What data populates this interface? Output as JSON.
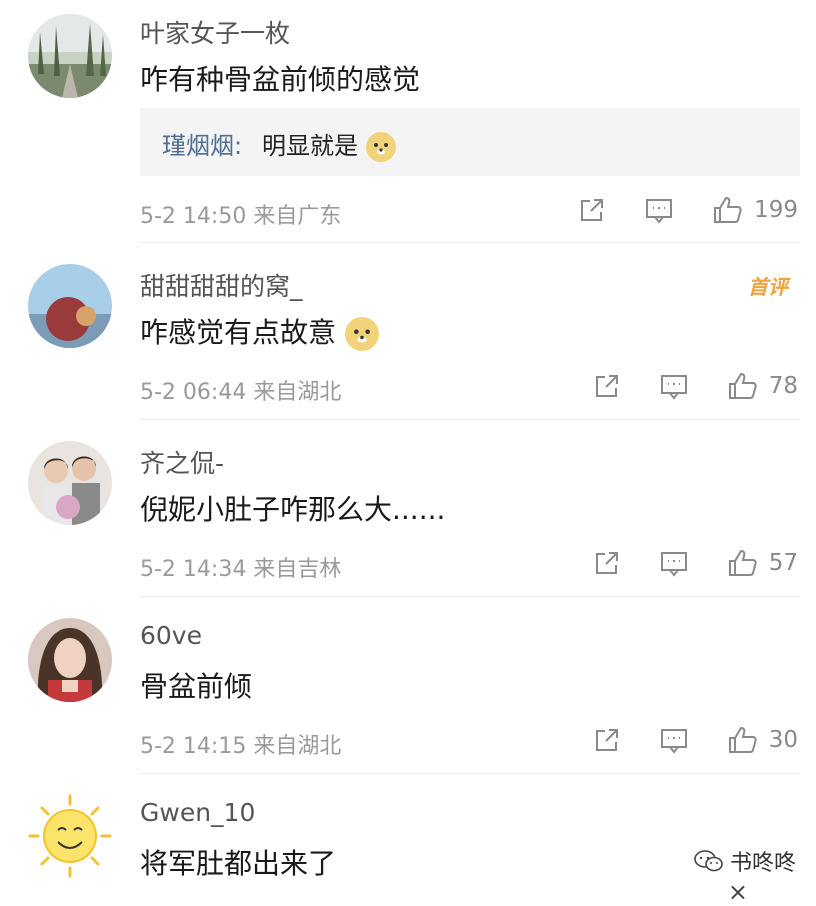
{
  "comments": [
    {
      "username": "叶家女子一枚",
      "text": "咋有种骨盆前倾的感觉",
      "reply": {
        "name": "瑾烟烟:",
        "text": "明显就是"
      },
      "date": "5-2 14:50",
      "location": "来自广东",
      "likes": "199"
    },
    {
      "username": "甜甜甜甜的窝_",
      "badge": "首评",
      "text": "咋感觉有点故意",
      "date": "5-2 06:44",
      "location": "来自湖北",
      "likes": "78"
    },
    {
      "username": "齐之侃-",
      "text": "倪妮小肚子咋那么大......",
      "date": "5-2 14:34",
      "location": "来自吉林",
      "likes": "57"
    },
    {
      "username": "60ve",
      "text": "骨盆前倾",
      "date": "5-2 14:15",
      "location": "来自湖北",
      "likes": "30"
    },
    {
      "username": "Gwen_10",
      "text": "将军肚都出来了"
    }
  ],
  "watermark": {
    "text": "书咚咚"
  },
  "close_glyph": "×",
  "icons": {
    "share": "share-icon",
    "comment": "comment-icon",
    "like": "thumbs-up-icon",
    "doge": "doge-emoji-icon"
  }
}
